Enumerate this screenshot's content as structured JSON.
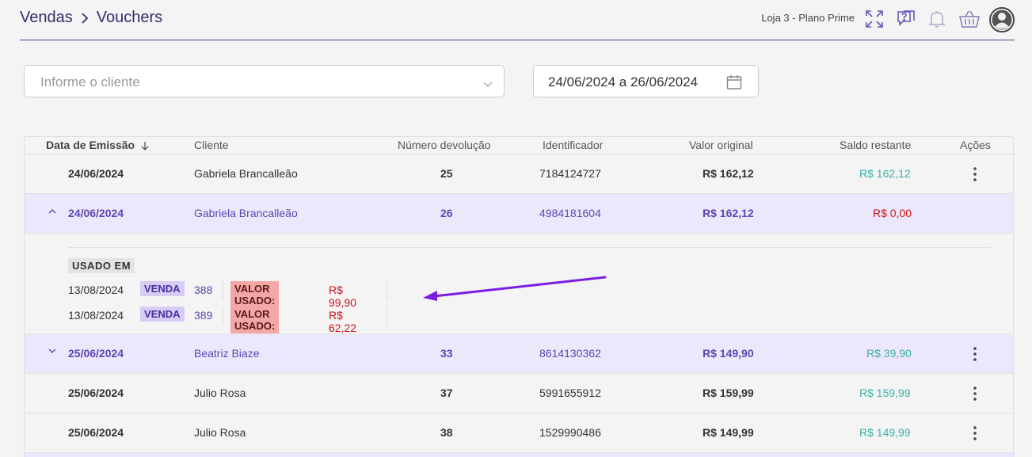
{
  "header": {
    "breadcrumb": [
      "Vendas",
      "Vouchers"
    ],
    "store": "Loja 3 - Plano Prime",
    "icons": [
      "expand-icon",
      "help-icon",
      "bell-icon",
      "basket-icon",
      "user-avatar-icon"
    ]
  },
  "filters": {
    "client_placeholder": "Informe o cliente",
    "date_range": "24/06/2024 a 26/06/2024"
  },
  "table": {
    "columns": [
      "Data de Emissão",
      "Cliente",
      "Número devolução",
      "Identificador",
      "Valor original",
      "Saldo restante",
      "Ações"
    ],
    "rows": [
      {
        "date": "24/06/2024",
        "client": "Gabriela Brancalleão",
        "number": "25",
        "id": "7184124727",
        "original": "R$ 162,12",
        "balance": "R$ 162,12"
      },
      {
        "date": "24/06/2024",
        "client": "Gabriela Brancalleão",
        "number": "26",
        "id": "4984181604",
        "original": "R$ 162,12",
        "balance": "R$ 0,00"
      },
      {
        "date": "25/06/2024",
        "client": "Beatriz Biaze",
        "number": "33",
        "id": "8614130362",
        "original": "R$ 149,90",
        "balance": "R$ 39,90"
      },
      {
        "date": "25/06/2024",
        "client": "Julio Rosa",
        "number": "37",
        "id": "5991655912",
        "original": "R$ 159,99",
        "balance": "R$ 159,99"
      },
      {
        "date": "25/06/2024",
        "client": "Julio Rosa",
        "number": "38",
        "id": "1529990486",
        "original": "R$ 149,99",
        "balance": "R$ 149,99"
      }
    ],
    "expanded": {
      "title": "USADO EM",
      "uses": [
        {
          "date": "13/08/2024",
          "type": "VENDA",
          "number": "388",
          "value_label": "VALOR USADO:",
          "value": "R$ 99,90"
        },
        {
          "date": "13/08/2024",
          "type": "VENDA",
          "number": "389",
          "value_label": "VALOR USADO:",
          "value": "R$ 62,22"
        }
      ]
    }
  },
  "colors": {
    "accent": "#5e46b4",
    "green": "#3bb0a8",
    "red": "#d1121c",
    "arrow": "#7a1ee6"
  }
}
